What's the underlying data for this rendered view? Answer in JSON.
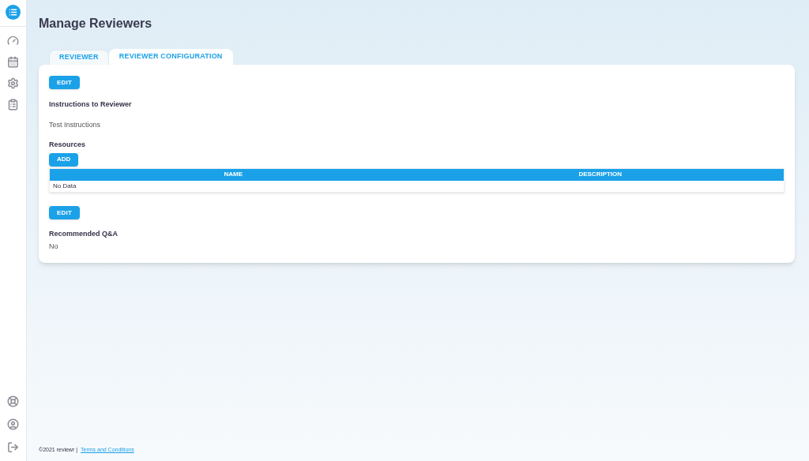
{
  "page_title": "Manage Reviewers",
  "tabs": [
    {
      "label": "REVIEWER",
      "selected": false
    },
    {
      "label": "REVIEWER CONFIGURATION",
      "selected": true
    }
  ],
  "instructions": {
    "edit_button": "EDIT",
    "heading": "Instructions to Reviewer",
    "text": "Test Instructions"
  },
  "resources": {
    "heading": "Resources",
    "add_button": "ADD",
    "table": {
      "columns": [
        "NAME",
        "DESCRIPTION"
      ],
      "empty_text": "No Data"
    }
  },
  "recommended": {
    "edit_button": "EDIT",
    "heading": "Recommended Q&A",
    "value": "No"
  },
  "footer": {
    "copyright": "©2021 reviewr |",
    "link": "Terms and Conditions"
  }
}
